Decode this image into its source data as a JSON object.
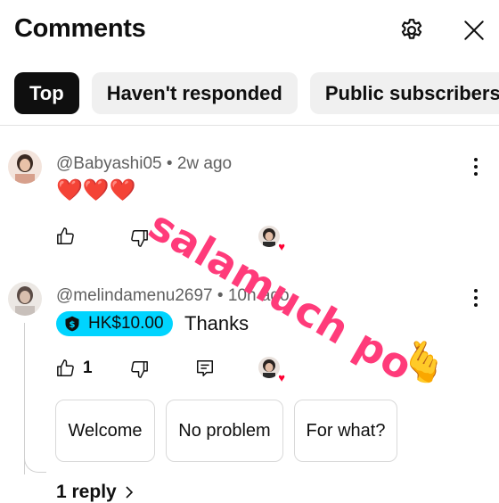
{
  "header": {
    "title": "Comments",
    "settings_icon": "gear-icon",
    "close_icon": "close-icon"
  },
  "filters": [
    {
      "label": "Top",
      "active": true
    },
    {
      "label": "Haven't responded",
      "active": false
    },
    {
      "label": "Public subscribers",
      "active": false
    }
  ],
  "comments": [
    {
      "author": "@Babyashi05",
      "time": "2w ago",
      "text": "❤️❤️❤️",
      "likes": "",
      "hearted": true
    },
    {
      "author": "@melindamenu2697",
      "time": "10h ago",
      "super_thanks": "HK$10.00",
      "text": "Thanks",
      "likes": "1",
      "hearted": true,
      "suggested_replies": [
        "Welcome",
        "No problem",
        "For what?"
      ],
      "replies_label": "1 reply"
    }
  ],
  "overlay": {
    "sticker_text": "salamuch po",
    "sticker_color": "#ff3b7a",
    "hand_emoji": "🫰"
  },
  "colors": {
    "accent_super_thanks": "#00d4ff",
    "heart": "#ff0033"
  }
}
